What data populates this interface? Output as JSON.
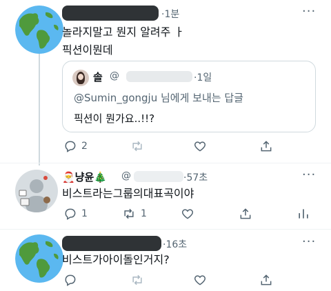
{
  "tweets": [
    {
      "avatar": "globe",
      "time": "1분",
      "text_lines": [
        "놀라지말고 뭔지 알려주 ㅏ",
        "픽션이뭔데"
      ],
      "more": "···",
      "quote": {
        "name": "솔",
        "handle": "@",
        "time": "1일",
        "reply_to": "@Sumin_gongju 님에게 보내는 답글",
        "text": "픽션이 뭔가요..!!?"
      },
      "actions": {
        "reply": "2",
        "retweet": "",
        "like": "",
        "share": ""
      }
    },
    {
      "avatar": "default-user",
      "name": "🎅냥윤🎄",
      "handle": "@",
      "time": "57초",
      "text": "비스트라는그룹의대표곡이야",
      "more": "···",
      "actions": {
        "reply": "1",
        "retweet": "1",
        "like": "",
        "share": "",
        "analytics": ""
      }
    },
    {
      "avatar": "globe",
      "time": "16초",
      "text": "비스트가아이돌인거지?",
      "more": "···",
      "actions": {
        "reply": "",
        "retweet": "",
        "like": "",
        "share": ""
      }
    }
  ],
  "colors": {
    "text": "#0f1419",
    "muted": "#536471",
    "border": "#cfd9de",
    "redact": "#2f3336"
  }
}
